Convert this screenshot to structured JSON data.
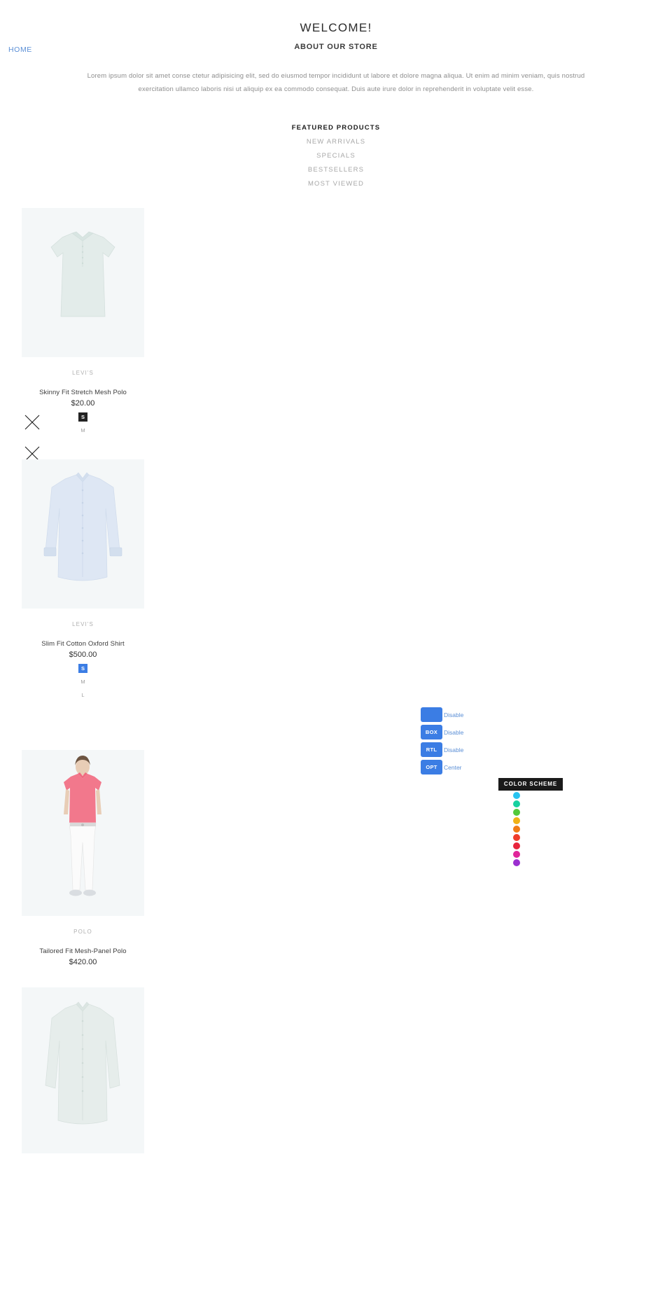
{
  "header": {
    "welcome_title": "WELCOME!",
    "about_subtitle": "ABOUT OUR STORE",
    "home_link": "HOME",
    "intro_text": "Lorem ipsum dolor sit amet conse ctetur adipisicing elit, sed do eiusmod tempor incididunt ut labore et dolore magna aliqua. Ut enim ad minim veniam, quis nostrud exercitation ullamco laboris nisi ut aliquip ex ea commodo consequat. Duis aute irure dolor in reprehenderit in voluptate velit esse."
  },
  "tabs": [
    {
      "label": "FEATURED PRODUCTS",
      "active": true
    },
    {
      "label": "NEW ARRIVALS",
      "active": false
    },
    {
      "label": "SPECIALS",
      "active": false
    },
    {
      "label": "BESTSELLERS",
      "active": false
    },
    {
      "label": "MOST VIEWED",
      "active": false
    }
  ],
  "products": [
    {
      "brand": "LEVI'S",
      "name": "Skinny Fit Stretch Mesh Polo",
      "price": "$20.00",
      "sizes": [
        {
          "label": "S",
          "state": "dark"
        },
        {
          "label": "M",
          "state": "plain"
        }
      ]
    },
    {
      "brand": "LEVI'S",
      "name": "Slim Fit Cotton Oxford Shirt",
      "price": "$500.00",
      "sizes": [
        {
          "label": "S",
          "state": "blue"
        },
        {
          "label": "M",
          "state": "plain"
        },
        {
          "label": "L",
          "state": "plain"
        }
      ]
    },
    {
      "brand": "POLO",
      "name": "Tailored Fit Mesh-Panel Polo",
      "price": "$420.00",
      "sizes": []
    },
    {
      "brand": "",
      "name": "",
      "price": "",
      "sizes": []
    }
  ],
  "settings_panel": {
    "rows": [
      {
        "button": "",
        "label": "Disable"
      },
      {
        "button": "BOX",
        "label": "Disable"
      },
      {
        "button": "RTL",
        "label": "Disable"
      },
      {
        "button": "OPT",
        "label": "Center"
      }
    ]
  },
  "color_scheme": {
    "title": "COLOR SCHEME",
    "colors": [
      "#27c3f0",
      "#17d1a0",
      "#53c93b",
      "#f0b217",
      "#f07c17",
      "#ef3c2a",
      "#e8253c",
      "#e0269a",
      "#9b2fd0"
    ]
  }
}
